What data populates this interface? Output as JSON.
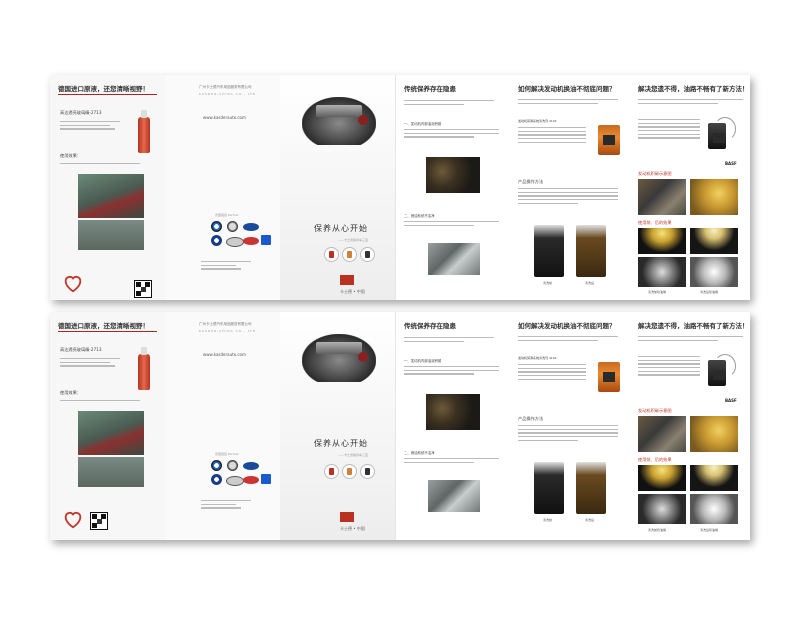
{
  "sheets": [
    {
      "p1": {
        "heading": "德国进口原液，还您清晰视野！",
        "product_label": "高达透亮玻璃精-2713",
        "usage_label": "使用效果："
      },
      "p2": {
        "company_cn": "广州卡士德汽车用品服务有限公司",
        "company_en": "KASDER-CHINA CO., LTD",
        "website": "www.kasderauto.com",
        "partners_label": "德国强劲 Partner"
      },
      "p3": {
        "slogan": "保养从心开始",
        "tagline": "——卡士德助养车三宝",
        "brand": "卡士德 • 中国"
      },
      "p4": {
        "heading": "传统保养存在隐患",
        "item1": "一、发动机内部油泥积碳",
        "item2": "二、燃油系统不洁净"
      },
      "p5": {
        "heading": "如何解决发动机换油不彻底问题？",
        "product": "发动机润滑系统清洗剂 4102",
        "method": "产品操作方法",
        "cap_before": "清洗前",
        "cap_after": "清洗后"
      },
      "p6": {
        "heading": "解决您遗不得，油路不畅有了新方法！",
        "demo_label": "发动机积碳示意图",
        "effect_label": "使用前、后的效果",
        "cap1": "清洗前喷油嘴",
        "cap2": "清洗后喷油嘴",
        "basf": "BASF"
      }
    },
    {
      "p1": {
        "heading": "德国进口原液，还您清晰视野！",
        "product_label": "高达透亮玻璃精-2713",
        "usage_label": "使用效果："
      },
      "p2": {
        "company_cn": "广州卡士德汽车用品服务有限公司",
        "company_en": "KASDER-CHINA CO., LTD",
        "website": "www.kasderauto.com",
        "partners_label": "德国强劲 Partner"
      },
      "p3": {
        "slogan": "保养从心开始",
        "tagline": "——卡士德助养车三宝",
        "brand": "卡士德 • 中国"
      },
      "p4": {
        "heading": "传统保养存在隐患",
        "item1": "一、发动机内部油泥积碳",
        "item2": "二、燃油系统不洁净"
      },
      "p5": {
        "heading": "如何解决发动机换油不彻底问题？",
        "product": "发动机润滑系统清洗剂 4102",
        "method": "产品操作方法",
        "cap_before": "清洗前",
        "cap_after": "清洗后"
      },
      "p6": {
        "heading": "解决您遗不得，油路不畅有了新方法！",
        "demo_label": "发动机积碳示意图",
        "effect_label": "使用前、后的效果",
        "cap1": "清洗前喷油嘴",
        "cap2": "清洗后喷油嘴",
        "basf": "BASF"
      }
    }
  ],
  "colors": {
    "accent_red": "#b22222",
    "brand_red": "#b8321f",
    "bg": "#ffffff"
  }
}
